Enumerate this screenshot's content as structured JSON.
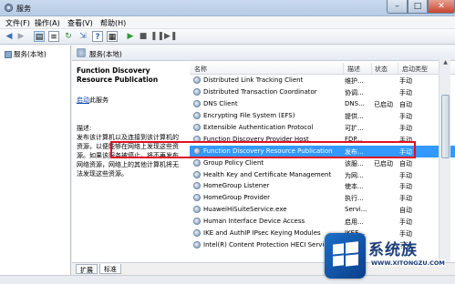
{
  "window": {
    "title": "服务",
    "colors": {
      "selection": "#3399ff",
      "highlight_box": "#e01020",
      "link": "#0645ad"
    }
  },
  "menubar": {
    "items": [
      "文件(F)",
      "操作(A)",
      "查看(V)",
      "帮助(H)"
    ]
  },
  "toolbar": {
    "icons": [
      "back-arrow-icon",
      "forward-arrow-icon",
      "console-tree-icon",
      "properties-icon",
      "refresh-icon",
      "export-icon",
      "help-icon",
      "details-icon",
      "play-icon",
      "stop-icon",
      "pause-icon",
      "restart-icon"
    ]
  },
  "tree": {
    "root_label": "服务(本地)"
  },
  "pane": {
    "header_label": "服务(本地)"
  },
  "description": {
    "service_name": "Function Discovery Resource Publication",
    "start_link": "启动",
    "start_suffix": "此服务",
    "desc_label": "描述:",
    "desc_text": "发布该计算机以及连接到该计算机的资源，以便能够在网络上发现这些资源。如果该服务被停止，将不再发布网络资源，网络上的其他计算机将无法发现这些资源。"
  },
  "list": {
    "columns": {
      "name": "名称",
      "desc": "描述",
      "status": "状态",
      "startup": "启动类型"
    },
    "rows": [
      {
        "name": "Distributed Link Tracking Client",
        "desc": "维护...",
        "status": "",
        "startup": "手动"
      },
      {
        "name": "Distributed Transaction Coordinator",
        "desc": "协调...",
        "status": "",
        "startup": "手动"
      },
      {
        "name": "DNS Client",
        "desc": "DNS...",
        "status": "已启动",
        "startup": "自动"
      },
      {
        "name": "Encrypting File System (EFS)",
        "desc": "提供...",
        "status": "",
        "startup": "手动"
      },
      {
        "name": "Extensible Authentication Protocol",
        "desc": "可扩...",
        "status": "",
        "startup": "手动"
      },
      {
        "name": "Function Discovery Provider Host",
        "desc": "FDP...",
        "status": "",
        "startup": "手动"
      },
      {
        "name": "Function Discovery Resource Publication",
        "desc": "发布...",
        "status": "",
        "startup": "手动"
      },
      {
        "name": "Group Policy Client",
        "desc": "该服...",
        "status": "已启动",
        "startup": "自动"
      },
      {
        "name": "Health Key and Certificate Management",
        "desc": "为网...",
        "status": "",
        "startup": "手动"
      },
      {
        "name": "HomeGroup Listener",
        "desc": "使本...",
        "status": "",
        "startup": "手动"
      },
      {
        "name": "HomeGroup Provider",
        "desc": "执行...",
        "status": "",
        "startup": "手动"
      },
      {
        "name": "HuaweiHiSuiteService.exe",
        "desc": "Servi...",
        "status": "",
        "startup": "自动"
      },
      {
        "name": "Human Interface Device Access",
        "desc": "启用...",
        "status": "",
        "startup": "手动"
      },
      {
        "name": "IKE and AuthIP IPsec Keying Modules",
        "desc": "IKEE...",
        "status": "",
        "startup": "手动"
      },
      {
        "name": "Intel(R) Content Protection HECI Service",
        "desc": "Intel...",
        "status": "",
        "startup": "手动"
      }
    ],
    "selected_index": 6
  },
  "tabs": {
    "extended": "扩展",
    "standard": "标准"
  },
  "watermark": {
    "title": "系统族",
    "url": "WWW.XITONGZU.COM"
  }
}
